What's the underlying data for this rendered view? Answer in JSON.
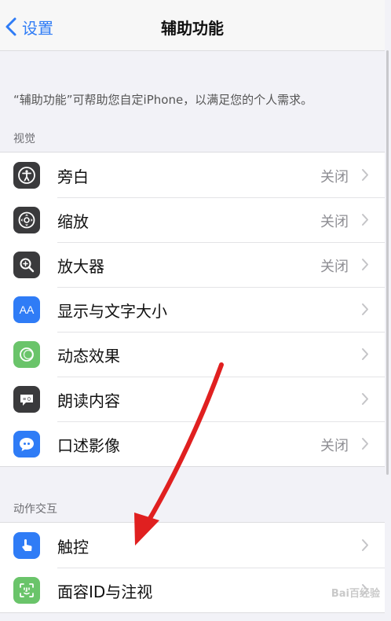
{
  "nav": {
    "back_label": "设置",
    "title": "辅助功能"
  },
  "description": "“辅助功能”可帮助您自定iPhone，以满足您的个人需求。",
  "sections": [
    {
      "header": "视觉",
      "rows": [
        {
          "label": "旁白",
          "value": "关闭",
          "icon": "voiceover-icon",
          "color": "#3a3a3c"
        },
        {
          "label": "缩放",
          "value": "关闭",
          "icon": "zoom-icon",
          "color": "#3a3a3c"
        },
        {
          "label": "放大器",
          "value": "关闭",
          "icon": "magnifier-icon",
          "color": "#3a3a3c"
        },
        {
          "label": "显示与文字大小",
          "value": "",
          "icon": "text-size-icon",
          "color": "#2f7cf6"
        },
        {
          "label": "动态效果",
          "value": "",
          "icon": "motion-icon",
          "color": "#6ac46a"
        },
        {
          "label": "朗读内容",
          "value": "",
          "icon": "spoken-content-icon",
          "color": "#3a3a3c"
        },
        {
          "label": "口述影像",
          "value": "关闭",
          "icon": "audio-description-icon",
          "color": "#2f7cf6"
        }
      ]
    },
    {
      "header": "动作交互",
      "rows": [
        {
          "label": "触控",
          "value": "",
          "icon": "touch-icon",
          "color": "#2f7cf6"
        },
        {
          "label": "面容ID与注视",
          "value": "",
          "icon": "face-id-icon",
          "color": "#6ac46a"
        }
      ]
    }
  ],
  "watermark": "Bai百经验",
  "colors": {
    "accent": "#2f7cf6",
    "arrow": "#e02020"
  }
}
